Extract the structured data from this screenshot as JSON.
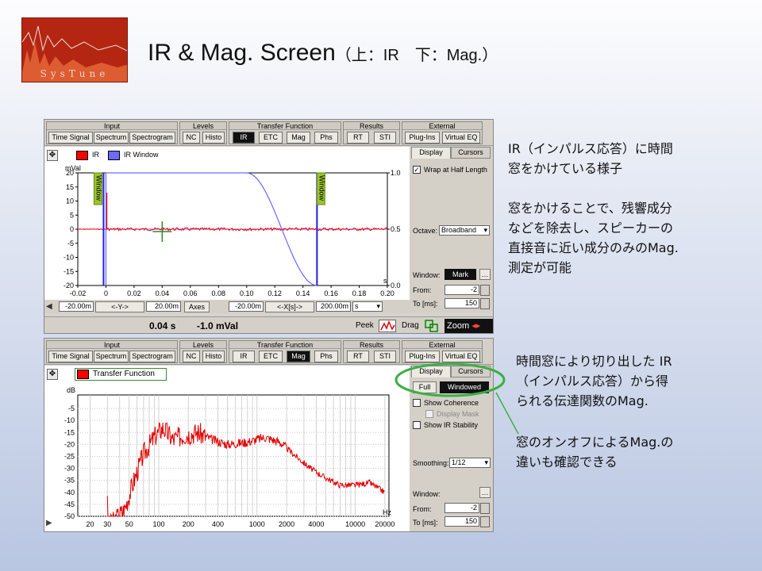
{
  "slide": {
    "title": "IR & Mag. Screen",
    "title_sub": "（上：IR　下：Mag.）",
    "logo_text": "SysTune"
  },
  "toolbar": {
    "groups": [
      {
        "label": "Input",
        "buttons": [
          "Time Signal",
          "Spectrum",
          "Spectrogram"
        ]
      },
      {
        "label": "Levels",
        "buttons": [
          "NC",
          "Histo"
        ]
      },
      {
        "label": "Transfer Function",
        "buttons": [
          "IR",
          "ETC",
          "Mag",
          "Phs"
        ]
      },
      {
        "label": "Results",
        "buttons": [
          "RT",
          "STI"
        ]
      },
      {
        "label": "External",
        "buttons": [
          "Plug-Ins",
          "Virtual EQ"
        ]
      }
    ]
  },
  "ir_panel": {
    "legend": [
      {
        "label": "IR",
        "color": "#ff0000"
      },
      {
        "label": "IR Window",
        "color": "#6a6aff"
      }
    ],
    "ylabel": "mVal",
    "y_ticks": [
      "20",
      "15",
      "10",
      "5",
      "0",
      "-5",
      "-10",
      "-15",
      "-20"
    ],
    "right_ticks": [
      "1.0",
      "0.5",
      "0.0"
    ],
    "x_ticks": [
      "-0.02",
      "0",
      "0.02",
      "0.04",
      "0.06",
      "0.08",
      "0.10",
      "0.12",
      "0.14",
      "0.16",
      "0.18",
      "0.20"
    ],
    "x_unit": "s",
    "window_marker": "Window",
    "side": {
      "tabs": [
        "Display",
        "Cursors"
      ],
      "wrap_label": "Wrap at Half Length",
      "octave_label": "Octave:",
      "octave_value": "Broadband",
      "window_label": "Window:",
      "window_button": "Mark",
      "from_label": "From:",
      "from_value": "-2",
      "to_label": "To [ms]:",
      "to_value": "150"
    },
    "scroll": {
      "y_from": "-20.00m",
      "y_btn": "<-Y->",
      "y_to": "20.00m",
      "axes_btn": "Axes",
      "x_from": "-20.00m",
      "x_btn": "<-X[s]->",
      "x_to": "200.00m",
      "x_unit": "s"
    },
    "status": {
      "time": "0.04 s",
      "value": "-1.0 mVal",
      "peek": "Peek",
      "drag": "Drag",
      "zoom": "Zoom"
    }
  },
  "mag_panel": {
    "legend": "Transfer Function",
    "ylabel": "dB",
    "y_ticks": [
      "-5",
      "-10",
      "-15",
      "-20",
      "-25",
      "-30",
      "-35",
      "-40",
      "-45",
      "-50"
    ],
    "x_ticks": [
      "20",
      "30",
      "50",
      "100",
      "200",
      "400",
      "1000",
      "2000",
      "4000",
      "10000",
      "20000"
    ],
    "x_unit": "Hz",
    "side": {
      "tabs": [
        "Display",
        "Cursors"
      ],
      "full_btn": "Full",
      "windowed_btn": "Windowed",
      "show_coherence": "Show Coherence",
      "display_mask": "Display Mask",
      "show_ir_stability": "Show IR Stability",
      "smoothing_label": "Smoothing:",
      "smoothing_value": "1/12",
      "window_label": "Window:",
      "from_label": "From:",
      "from_value": "-2",
      "to_label": "To [ms]:",
      "to_value": "150"
    }
  },
  "notes": {
    "n1": [
      "IR（インパルス応答）に時間",
      "窓をかけている様子"
    ],
    "n2": [
      "窓をかけることで、残響成分",
      "などを除去し、スピーカーの",
      "直接音に近い成分のみのMag.",
      "測定が可能"
    ],
    "n3": [
      "時間窓により切り出した IR",
      "（インパルス応答）から得",
      "られる伝達関数のMag."
    ],
    "n4": [
      "窓のオンオフによるMag.の",
      "違いも確認できる"
    ]
  },
  "colors": {
    "ir_trace": "#ff0000",
    "ir_window": "#6a6aff",
    "callout": "#3cb043"
  }
}
